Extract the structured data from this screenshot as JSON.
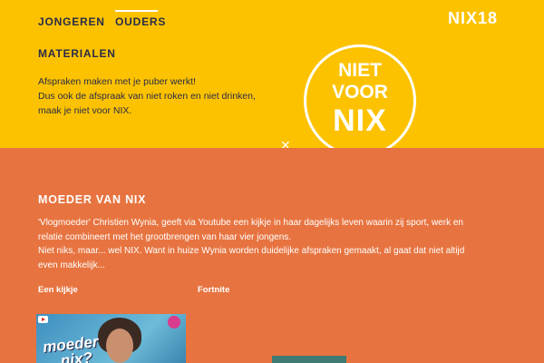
{
  "nav": {
    "jongeren": "JONGEREN",
    "ouders": "OUDERS",
    "materialen": "MATERIALEN"
  },
  "logo": "NIX18",
  "intro": {
    "line1": "Afspraken maken met je puber werkt!",
    "line2": "Dus ook de afspraak van niet roken en niet drinken,",
    "line3": "maak je niet voor NIX."
  },
  "badge": {
    "line1": "NIET",
    "line2": "VOOR",
    "line3": "NIX"
  },
  "section": {
    "title": "MOEDER VAN NIX",
    "p1_line1": "'Vlogmoeder' Christien Wynia, geeft via Youtube een kijkje in haar dagelijks leven waarin zij sport, werk en",
    "p1_line2": "relatie combineert met het grootbrengen van haar vier jongens.",
    "p2_line1": "Niet niks, maar... wel NIX. Want in huize Wynia worden duidelijke afspraken gemaakt, al gaat dat niet altijd",
    "p2_line2": "even makkelijk...",
    "label_kijkje": "Een kijkje",
    "label_fortnite": "Fortnite",
    "video_title_l1": "moeder",
    "video_title_l2": "nix?"
  },
  "colors": {
    "top_bg": "#fcc200",
    "bottom_bg": "#e77440",
    "nav_text": "#2a2c4a",
    "accent": "#ffffff"
  },
  "icons": [
    "youtube-icon",
    "close-x-icon"
  ]
}
